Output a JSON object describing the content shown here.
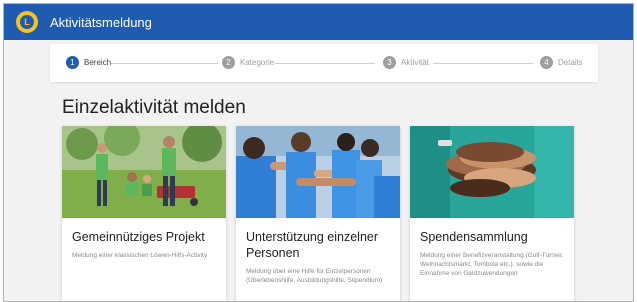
{
  "app": {
    "title": "Aktivitätsmeldung",
    "logo_icon": "lions-logo-icon",
    "logo_text": "L"
  },
  "stepper": {
    "steps": [
      {
        "number": "1",
        "label": "Bereich",
        "active": true
      },
      {
        "number": "2",
        "label": "Kategorie",
        "active": false
      },
      {
        "number": "3",
        "label": "Aktivität",
        "active": false
      },
      {
        "number": "4",
        "label": "Details",
        "active": false
      }
    ]
  },
  "main": {
    "heading": "Einzelaktivität melden",
    "cards": [
      {
        "title": "Gemeinnütziges Projekt",
        "description": "Meldung einer klassischen Löwen-Hilfs-Activity",
        "image": "volunteers-gardening-photo"
      },
      {
        "title": "Unterstützung einzelner Personen",
        "description": "Meldung über eine Hilfe für Einzelpersonen (Überlebenshilfe, Ausbildungshilfe, Stipendium)",
        "image": "volunteers-highfive-photo"
      },
      {
        "title": "Spendensammlung",
        "description": "Meldung einer Benefizveranstaltung (Golf-Turnier, Weihnachtsmarkt, Tombola etc.), sowie die Einnahme von Geldzuwendungen",
        "image": "stacked-hands-photo"
      }
    ]
  },
  "colors": {
    "appbar": "#1f5cb1",
    "logo": "#f7c21b",
    "active_step": "#1f5cb1",
    "inactive_step": "#9e9e9e"
  }
}
